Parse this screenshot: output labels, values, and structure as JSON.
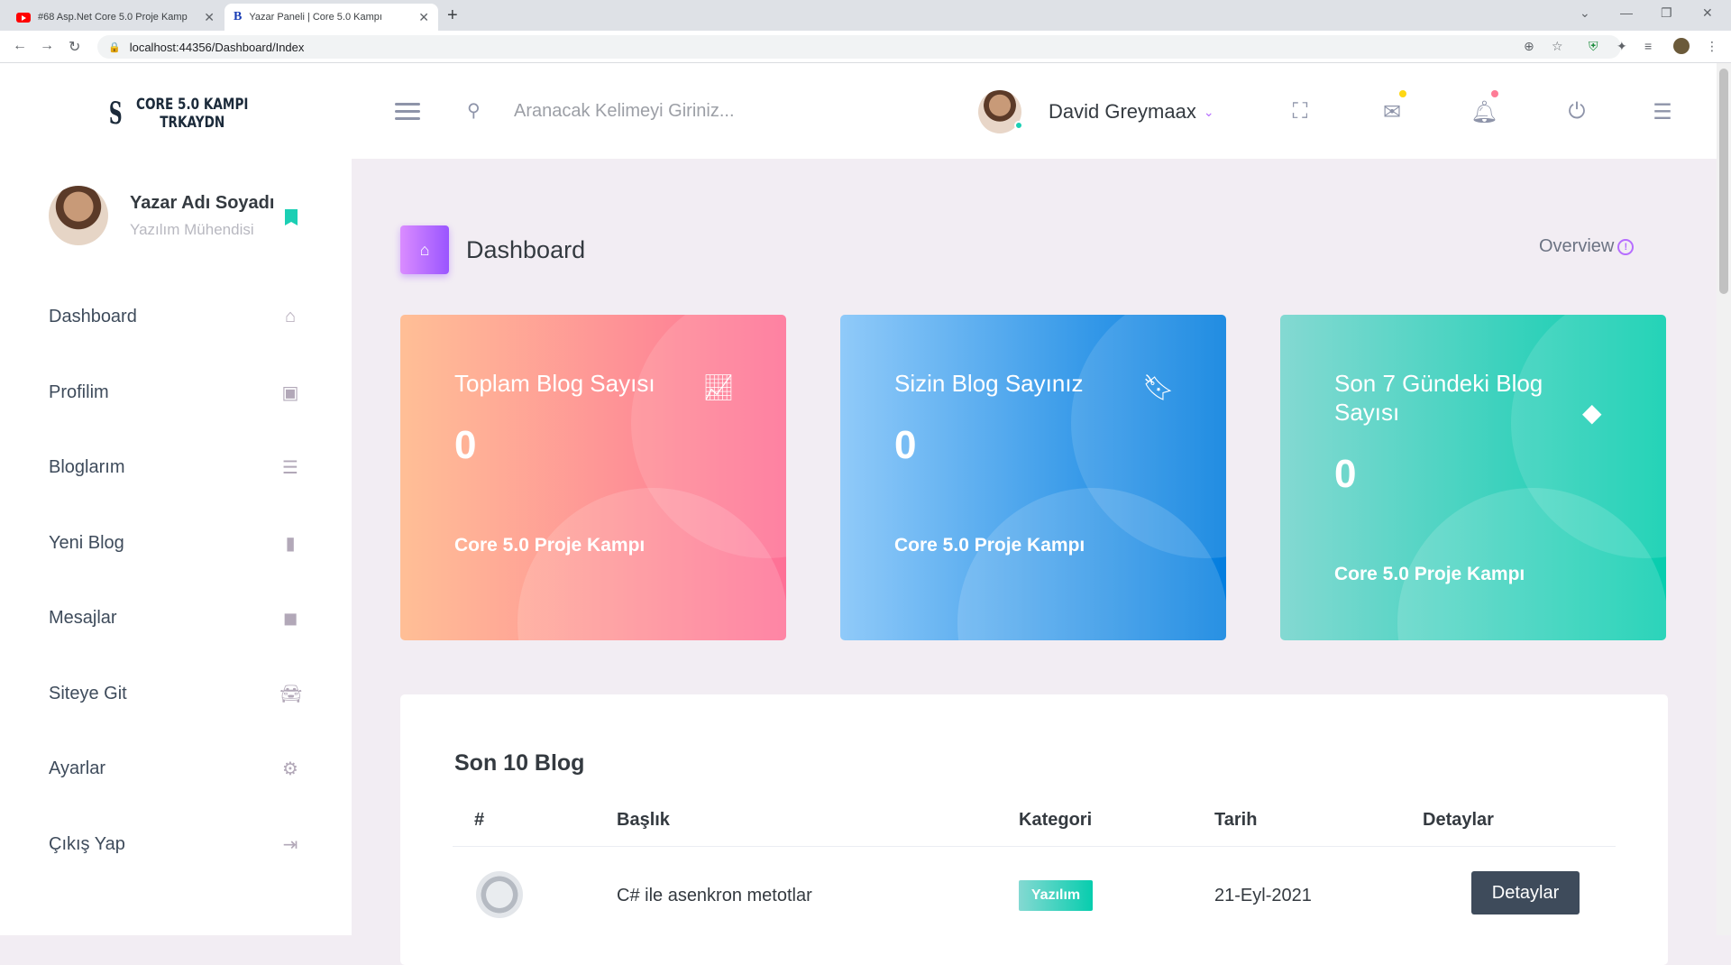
{
  "browser": {
    "tabs": [
      {
        "title": "#68 Asp.Net Core 5.0 Proje Kamp",
        "icon": "youtube-icon"
      },
      {
        "title": "Yazar Paneli | Core 5.0 Kampı",
        "icon": "b-favicon"
      }
    ],
    "url": "localhost:44356/Dashboard/Index"
  },
  "brand": {
    "line1": "CORE 5.0 KAMPI",
    "line2": "TRKAYDN"
  },
  "search": {
    "placeholder": "Aranacak Kelimeyi Giriniz..."
  },
  "topbar": {
    "user_name": "David Greymaax"
  },
  "profile": {
    "name": "Yazar Adı Soyadı",
    "role": "Yazılım Mühendisi"
  },
  "menu": [
    {
      "label": "Dashboard",
      "icon": "home-icon"
    },
    {
      "label": "Profilim",
      "icon": "contact-card-icon"
    },
    {
      "label": "Bloglarım",
      "icon": "list-icon"
    },
    {
      "label": "Yeni Blog",
      "icon": "bar-chart-icon"
    },
    {
      "label": "Mesajlar",
      "icon": "message-icon"
    },
    {
      "label": "Siteye Git",
      "icon": "car-icon"
    },
    {
      "label": "Ayarlar",
      "icon": "gear-icon"
    },
    {
      "label": "Çıkış Yap",
      "icon": "logout-icon"
    }
  ],
  "page": {
    "title": "Dashboard",
    "overview": "Overview"
  },
  "cards": [
    {
      "title": "Toplam Blog Sayısı",
      "value": "0",
      "footer": "Core 5.0 Proje Kampı",
      "icon": "line-chart-icon",
      "colors": [
        "#ffbf96",
        "#fe7096"
      ]
    },
    {
      "title": "Sizin Blog Sayınız",
      "value": "0",
      "footer": "Core 5.0 Proje Kampı",
      "icon": "bookmark-icon",
      "colors": [
        "#90caf9",
        "#047edf"
      ]
    },
    {
      "title": "Son 7 Gündeki Blog Sayısı",
      "value": "0",
      "footer": "Core 5.0 Proje Kampı",
      "icon": "diamond-icon",
      "colors": [
        "#84d9d2",
        "#07cdae"
      ]
    }
  ],
  "table": {
    "title": "Son 10 Blog",
    "headers": [
      "#",
      "Başlık",
      "Kategori",
      "Tarih",
      "Detaylar"
    ],
    "rows": [
      {
        "title": "C# ile asenkron metotlar",
        "category": "Yazılım",
        "date": "21-Eyl-2021",
        "button": "Detaylar"
      }
    ]
  }
}
